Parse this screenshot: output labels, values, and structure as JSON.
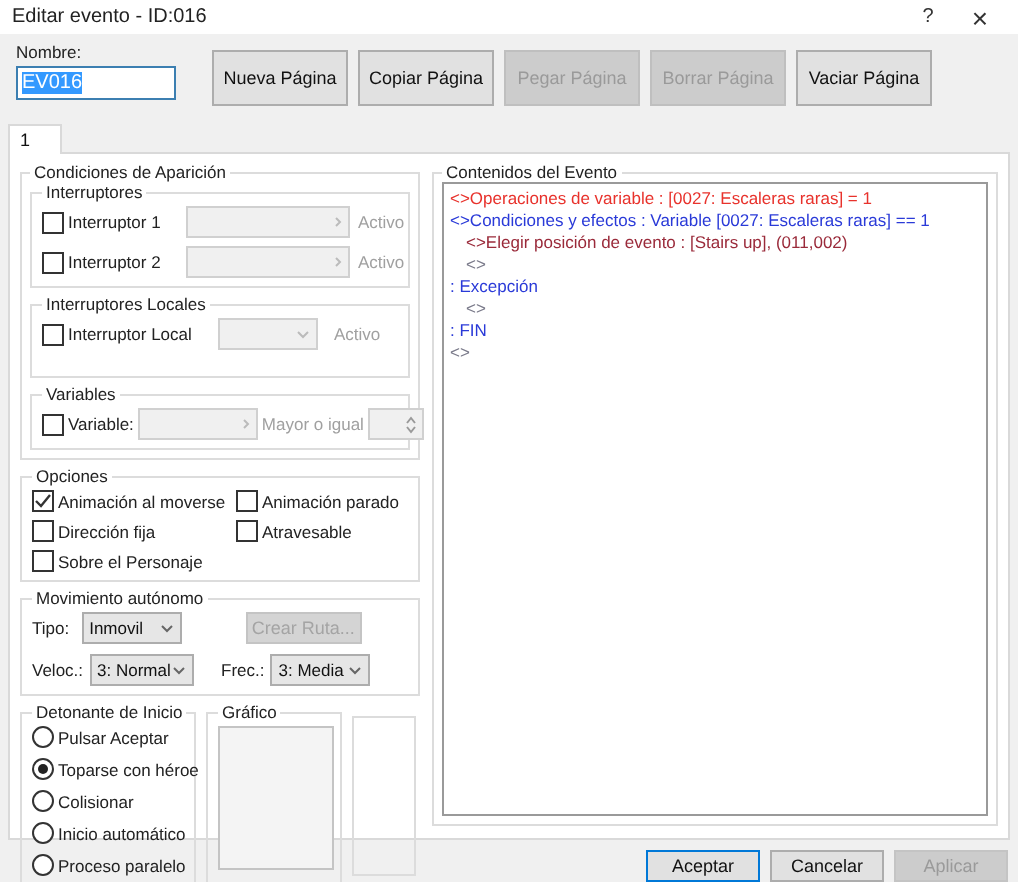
{
  "window": {
    "title": "Editar evento - ID:016",
    "help": "?",
    "close": "×"
  },
  "name": {
    "label": "Nombre:",
    "value": "EV016",
    "selected": true
  },
  "page_buttons": [
    {
      "label": "Nueva Página",
      "disabled": false
    },
    {
      "label": "Copiar Página",
      "disabled": false
    },
    {
      "label": "Pegar Página",
      "disabled": true
    },
    {
      "label": "Borrar Página",
      "disabled": true
    },
    {
      "label": "Vaciar Página",
      "disabled": false
    }
  ],
  "tabs": [
    {
      "label": "1",
      "selected": true
    }
  ],
  "conditions": {
    "title": "Condiciones de Aparición",
    "switches": {
      "title": "Interruptores",
      "items": [
        {
          "label": "Interruptor 1",
          "checked": false,
          "state": "Activo"
        },
        {
          "label": "Interruptor 2",
          "checked": false,
          "state": "Activo"
        }
      ]
    },
    "local_switch": {
      "title": "Interruptores Locales",
      "label": "Interruptor Local",
      "checked": false,
      "state": "Activo"
    },
    "variable": {
      "title": "Variables",
      "label": "Variable:",
      "checked": false,
      "comparison": "Mayor o igual"
    }
  },
  "options": {
    "title": "Opciones",
    "items": [
      {
        "label": "Animación al moverse",
        "checked": true
      },
      {
        "label": "Animación parado",
        "checked": false
      },
      {
        "label": "Dirección fija",
        "checked": false
      },
      {
        "label": "Atravesable",
        "checked": false
      },
      {
        "label": "Sobre el Personaje",
        "checked": false
      }
    ]
  },
  "movement": {
    "title": "Movimiento autónomo",
    "type_label": "Tipo:",
    "type": "Inmovil",
    "route_button": "Crear Ruta...",
    "speed_label": "Veloc.:",
    "speed": "3: Normal",
    "freq_label": "Frec.:",
    "freq": "3: Media"
  },
  "trigger": {
    "title": "Detonante de Inicio",
    "options": [
      {
        "label": "Pulsar Aceptar",
        "selected": false
      },
      {
        "label": "Toparse con héroe",
        "selected": true
      },
      {
        "label": "Colisionar",
        "selected": false
      },
      {
        "label": "Inicio automático",
        "selected": false
      },
      {
        "label": "Proceso paralelo",
        "selected": false
      }
    ]
  },
  "graphic": {
    "title": "Gráfico"
  },
  "contents": {
    "title": "Contenidos del Evento",
    "lines": [
      {
        "text": "<>Operaciones de variable : [0027: Escaleras raras] = 1",
        "color": "#e8322c"
      },
      {
        "text": "<>Condiciones y efectos : Variable [0027: Escaleras raras] == 1",
        "color": "#2a3ad8",
        "children": [
          {
            "text": "<>Elegir posición de evento : [Stairs up], (011,002)",
            "color": "#9a2a3a"
          },
          {
            "text": "<>",
            "color": "#7a7a8a"
          }
        ]
      },
      {
        "text": ": Excepción",
        "color": "#2a3ad8",
        "children": [
          {
            "text": "<>",
            "color": "#7a7a8a"
          }
        ]
      },
      {
        "text": ": FIN",
        "color": "#2a3ad8"
      },
      {
        "text": "<>",
        "color": "#7a7a8a"
      }
    ]
  },
  "footer_buttons": [
    {
      "label": "Aceptar",
      "default": true,
      "disabled": false
    },
    {
      "label": "Cancelar",
      "default": false,
      "disabled": false
    },
    {
      "label": "Aplicar",
      "default": false,
      "disabled": true
    }
  ]
}
